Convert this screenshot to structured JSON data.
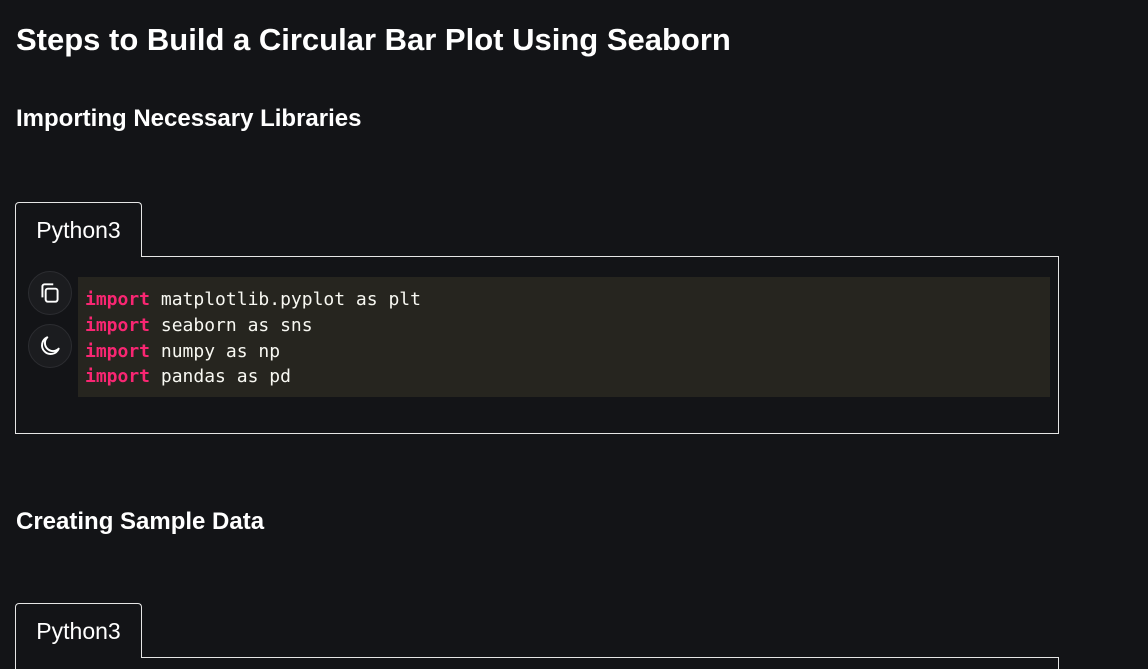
{
  "article": {
    "title": "Steps to Build a Circular Bar Plot Using Seaborn",
    "sections": [
      {
        "heading": "Importing Necessary Libraries",
        "tab_label": "Python3",
        "code_lines": [
          {
            "keyword": "import",
            "rest": " matplotlib.pyplot as plt"
          },
          {
            "keyword": "import",
            "rest": " seaborn as sns"
          },
          {
            "keyword": "import",
            "rest": " numpy as np"
          },
          {
            "keyword": "import",
            "rest": " pandas as pd"
          }
        ]
      },
      {
        "heading": "Creating Sample Data",
        "tab_label": "Python3"
      }
    ]
  },
  "toolbar": {
    "copy_icon": "copy-icon",
    "theme_icon": "moon-icon"
  },
  "colors": {
    "background": "#131417",
    "code_background": "#26251f",
    "keyword": "#f92672",
    "code_text": "#f8f8f2",
    "border": "#e6e6e6"
  }
}
